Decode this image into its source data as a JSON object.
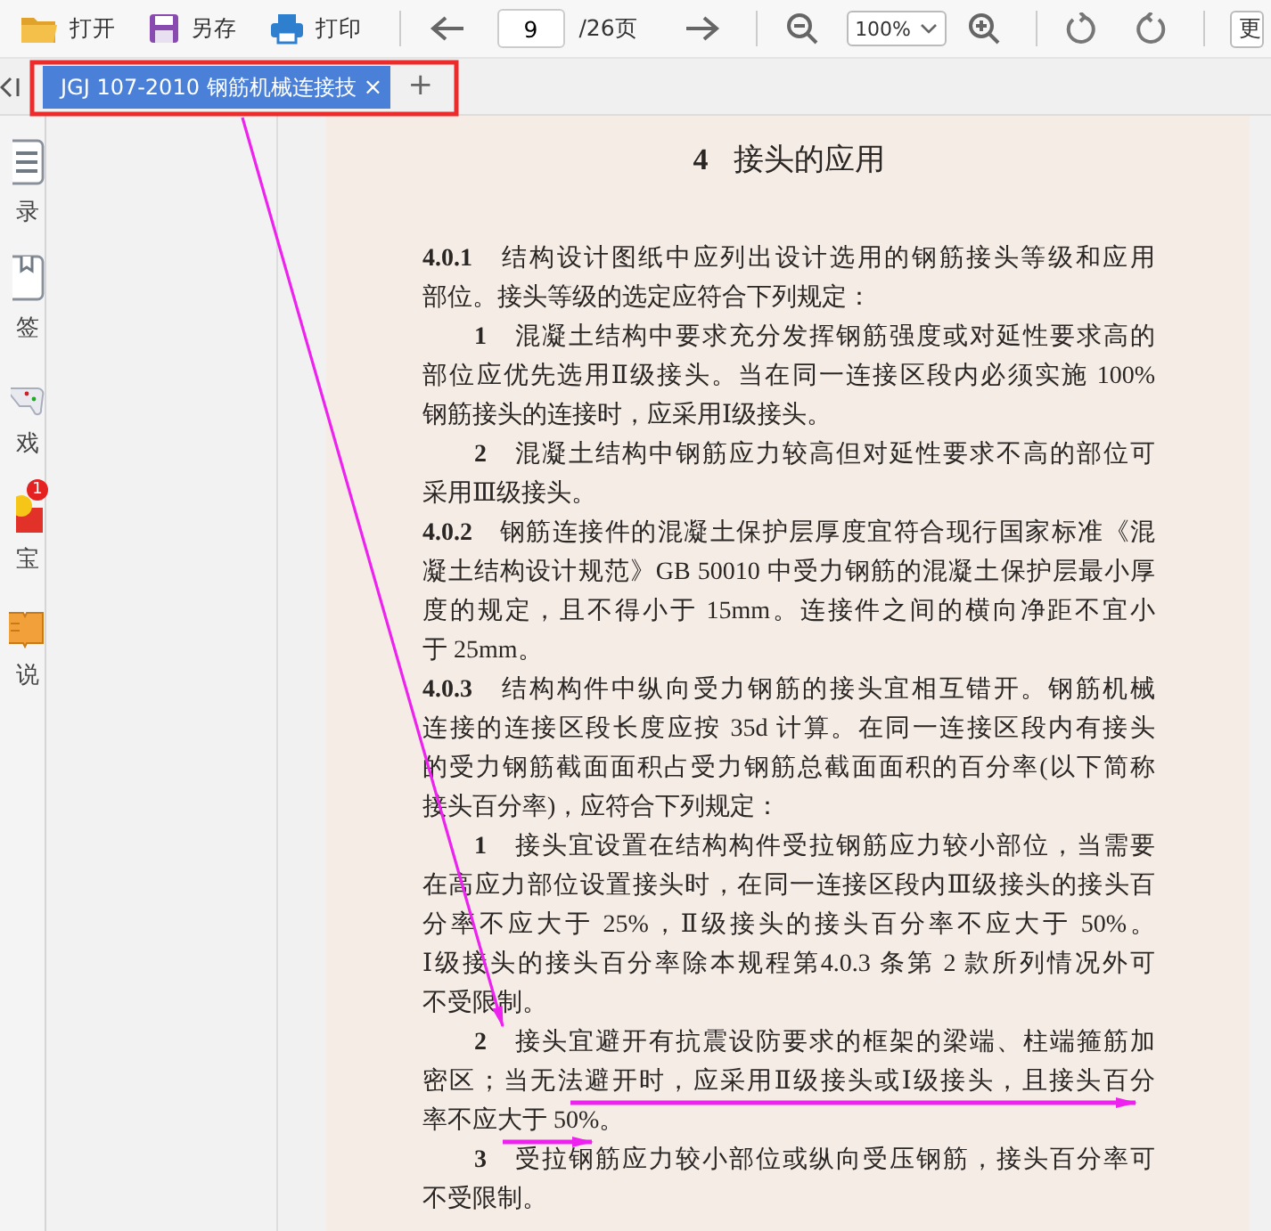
{
  "toolbar": {
    "buttons": [
      {
        "kind": "open",
        "label": "打开"
      },
      {
        "kind": "save",
        "label": "另存"
      },
      {
        "kind": "print",
        "label": "打印"
      }
    ],
    "page_field": {
      "value": "9"
    },
    "page_total": "/26页",
    "zoom_select": {
      "value": "100%"
    },
    "change_button": "更"
  },
  "tabs": [
    {
      "label": "JGJ 107-2010 钢筋机械连接技",
      "selected": true,
      "close": "×"
    }
  ],
  "new_tab": "+",
  "sidebar": {
    "items": [
      {
        "kind": "toc",
        "label": "录"
      },
      {
        "kind": "bookmark",
        "label": "签"
      },
      {
        "kind": "game",
        "label": "戏"
      },
      {
        "kind": "gift",
        "label": "宝",
        "badge": "1"
      },
      {
        "kind": "book",
        "label": "说"
      }
    ]
  },
  "document": {
    "heading_number": "4",
    "heading": "接头的应用",
    "paragraphs": [
      {
        "indent": false,
        "lines": [
          "**4.0.1**　结构设计图纸中应列出设计选用的钢筋接头等级和应用",
          "部位。接头等级的选定应符合下列规定："
        ]
      },
      {
        "indent": true,
        "lines": [
          "**1**　混凝土结构中要求充分发挥钢筋强度或对延性要求高的",
          "部位应优先选用Ⅱ级接头。当在同一连接区段内必须实施 100%",
          "钢筋接头的连接时，应采用Ⅰ级接头。"
        ]
      },
      {
        "indent": true,
        "lines": [
          "**2**　混凝土结构中钢筋应力较高但对延性要求不高的部位可",
          "采用Ⅲ级接头。"
        ]
      },
      {
        "indent": false,
        "lines": [
          "**4.0.2**　钢筋连接件的混凝土保护层厚度宜符合现行国家标准《混",
          "凝土结构设计规范》GB 50010 中受力钢筋的混凝土保护层最小厚",
          "度的规定，且不得小于 15mm。连接件之间的横向净距不宜小",
          "于 25mm。"
        ]
      },
      {
        "indent": false,
        "lines": [
          "**4.0.3**　结构构件中纵向受力钢筋的接头宜相互错开。钢筋机械",
          "连接的连接区段长度应按 35d 计算。在同一连接区段内有接头",
          "的受力钢筋截面面积占受力钢筋总截面面积的百分率(以下简称",
          "接头百分率)，应符合下列规定："
        ]
      },
      {
        "indent": true,
        "lines": [
          "**1**　接头宜设置在结构构件受拉钢筋应力较小部位，当需要",
          "在高应力部位设置接头时，在同一连接区段内Ⅲ级接头的接头百",
          "分率不应大于 25%，Ⅱ级接头的接头百分率不应大于 50%。",
          "Ⅰ级接头的接头百分率除本规程第4.0.3 条第 2 款所列情况外可",
          "不受限制。"
        ]
      },
      {
        "indent": true,
        "lines": [
          "**2**　接头宜避开有抗震设防要求的框架的梁端、柱端箍筋加",
          "密区；当无法避开时，应采用Ⅱ级接头或Ⅰ级接头，且接头百分",
          "率不应大于 50%。"
        ]
      },
      {
        "indent": true,
        "lines": [
          "**3**　受拉钢筋应力较小部位或纵向受压钢筋，接头百分率可",
          "不受限制。"
        ]
      }
    ]
  }
}
